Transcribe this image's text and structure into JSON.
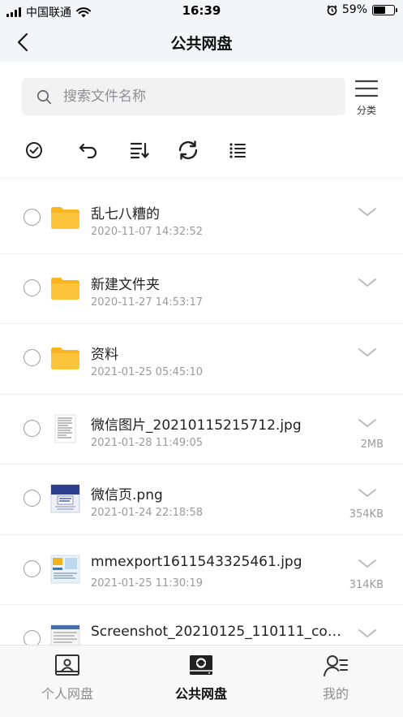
{
  "status_bar": {
    "carrier": "中国联通",
    "time": "16:39",
    "battery": "59%",
    "battery_level": 0.59
  },
  "nav": {
    "title": "公共网盘"
  },
  "search": {
    "placeholder": "搜索文件名称"
  },
  "classify_label": "分类",
  "files": [
    {
      "name": "乱七八糟的",
      "date": "2020-11-07 14:32:52",
      "size": "",
      "type": "folder"
    },
    {
      "name": "新建文件夹",
      "date": "2020-11-27 14:53:17",
      "size": "",
      "type": "folder"
    },
    {
      "name": "资料",
      "date": "2021-01-25 05:45:10",
      "size": "",
      "type": "folder"
    },
    {
      "name": "微信图片_20210115215712.jpg",
      "date": "2021-01-28 11:49:05",
      "size": "2MB",
      "type": "image-doc"
    },
    {
      "name": "微信页.png",
      "date": "2021-01-24 22:18:58",
      "size": "354KB",
      "type": "image-blue"
    },
    {
      "name": "mmexport1611543325461.jpg",
      "date": "2021-01-25 11:30:19",
      "size": "314KB",
      "type": "image-poster"
    },
    {
      "name": "Screenshot_20210125_110111_com.te...",
      "date": "",
      "size": "",
      "type": "image-screen"
    }
  ],
  "tabs": [
    {
      "label": "个人网盘",
      "active": false,
      "icon": "personal-drive-icon"
    },
    {
      "label": "公共网盘",
      "active": true,
      "icon": "public-drive-icon"
    },
    {
      "label": "我的",
      "active": false,
      "icon": "profile-icon"
    }
  ],
  "colors": {
    "folder": "#fbbd27",
    "active_tab": "#111111",
    "inactive_tab": "#8e8e8e"
  }
}
